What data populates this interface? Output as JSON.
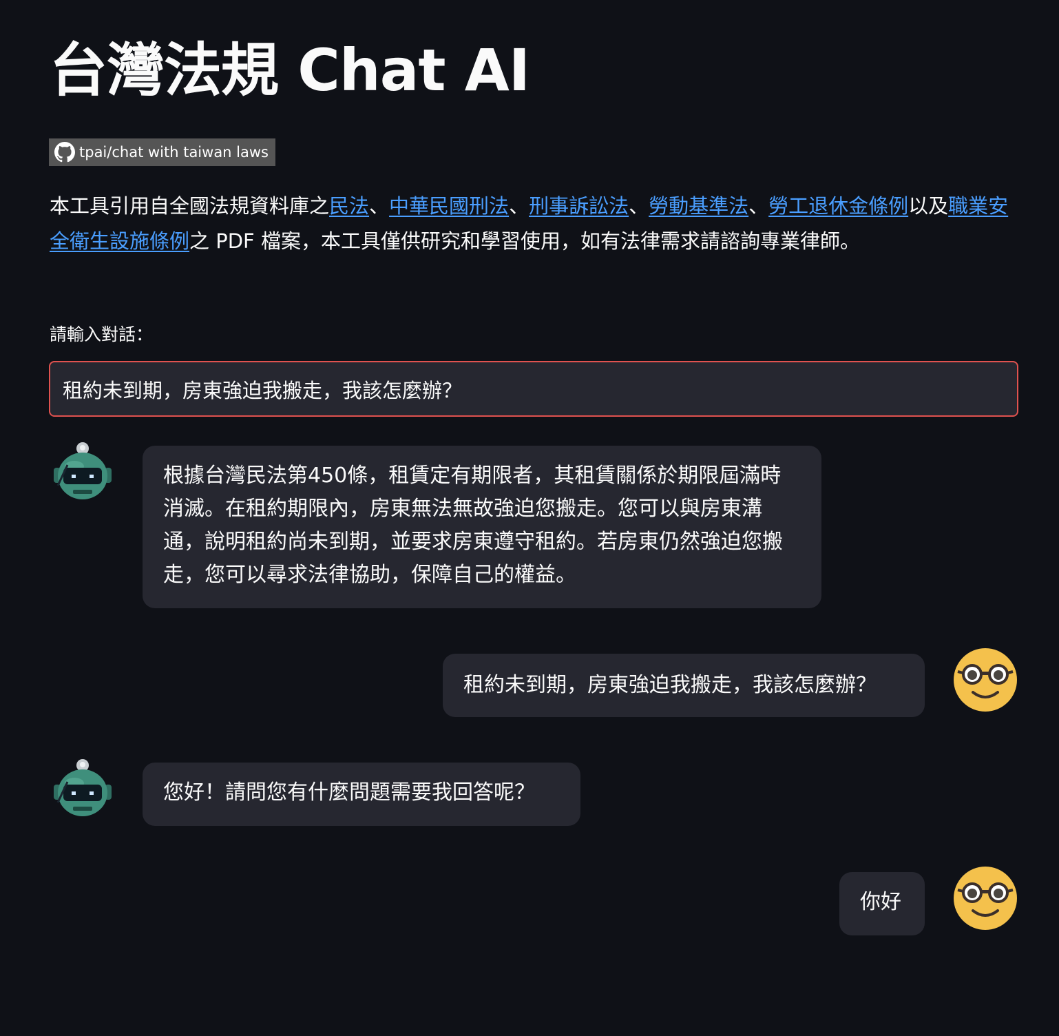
{
  "header": {
    "title": "台灣法規 Chat AI"
  },
  "badge": {
    "label": "tpai/chat with taiwan laws",
    "icon": "github-icon"
  },
  "description": {
    "prefix": "本工具引用自全國法規資料庫之",
    "links": [
      "民法",
      "中華民國刑法",
      "刑事訴訟法",
      "勞動基準法",
      "勞工退休金條例",
      "職業安全衛生設施條例"
    ],
    "separator": "、",
    "joiner": "以及",
    "suffix": "之 PDF 檔案，本工具僅供研究和學習使用，如有法律需求請諮詢專業律師。"
  },
  "input": {
    "label": "請輸入對話：",
    "value": "租約未到期，房東強迫我搬走，我該怎麼辦？"
  },
  "messages": [
    {
      "role": "assistant",
      "avatar": "robot-avatar-icon",
      "text": "根據台灣民法第450條，租賃定有期限者，其租賃關係於期限屆滿時消滅。在租約期限內，房東無法無故強迫您搬走。您可以與房東溝通，說明租約尚未到期，並要求房東遵守租約。若房東仍然強迫您搬走，您可以尋求法律協助，保障自己的權益。"
    },
    {
      "role": "user",
      "avatar": "nerd-face-avatar-icon",
      "text": "租約未到期，房東強迫我搬走，我該怎麼辦？"
    },
    {
      "role": "assistant",
      "avatar": "robot-avatar-icon",
      "text": "您好！請問您有什麼問題需要我回答呢？"
    },
    {
      "role": "user",
      "avatar": "nerd-face-avatar-icon",
      "text": "你好"
    }
  ],
  "colors": {
    "background": "#0f1117",
    "bubble": "#262730",
    "link": "#4a9eff",
    "input_border": "#e0524f",
    "badge": "#555555",
    "robot": "#3f8f7c",
    "user_avatar": "#f4c14c"
  }
}
